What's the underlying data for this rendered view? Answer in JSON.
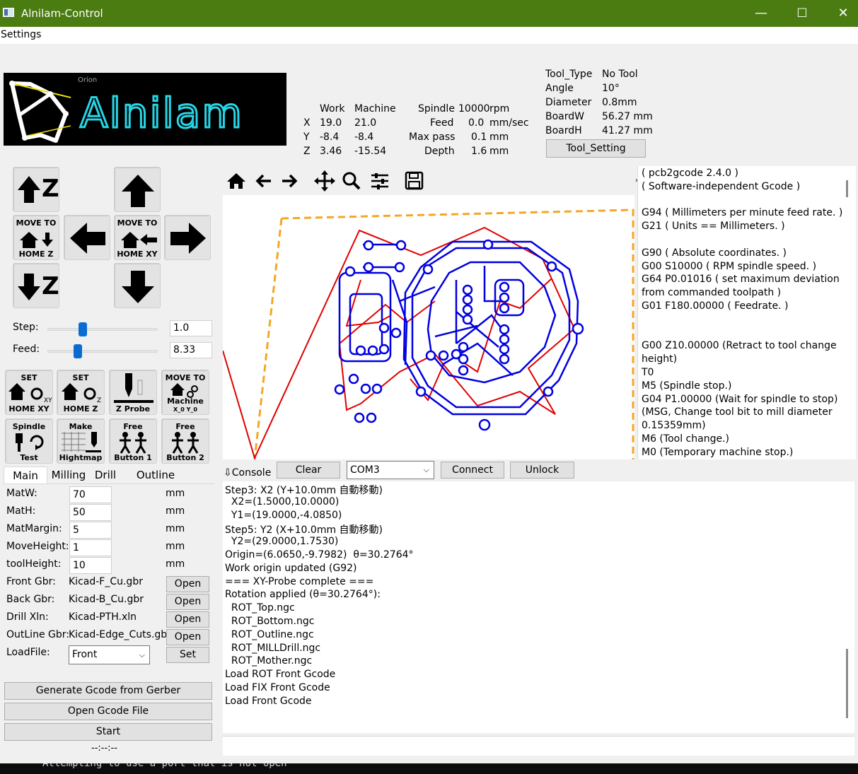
{
  "window": {
    "title": "Alnilam-Control",
    "minimize": "—",
    "maximize": "☐",
    "close": "✕"
  },
  "menu": {
    "settings": "Settings"
  },
  "logo": {
    "brand": "Alnilam",
    "sub": "Orion"
  },
  "coords": {
    "hdr_work": "Work",
    "hdr_machine": "Machine",
    "x_label": "X",
    "x_work": "19.0",
    "x_machine": "21.0",
    "y_label": "Y",
    "y_work": "-8.4",
    "y_machine": "-8.4",
    "z_label": "Z",
    "z_work": "3.46",
    "z_machine": "-15.54"
  },
  "spindle": {
    "spindle_label": "Spindle",
    "spindle_value": "10000",
    "spindle_unit": "rpm",
    "feed_label": "Feed",
    "feed_value": "0.0",
    "feed_unit": "mm/sec",
    "maxpass_label": "Max pass",
    "maxpass_value": "0.1",
    "maxpass_unit": "mm",
    "depth_label": "Depth",
    "depth_value": "1.6",
    "depth_unit": "mm"
  },
  "tool": {
    "type_label": "Tool_Type",
    "type_value": "No Tool",
    "angle_label": "Angle",
    "angle_value": "10°",
    "diameter_label": "Diameter",
    "diameter_value": "0.8mm",
    "boardw_label": "BoardW",
    "boardw_value": "56.27 mm",
    "boardh_label": "BoardH",
    "boardh_value": "41.27 mm",
    "setting_button": "Tool_Setting"
  },
  "jog": {
    "up_z": "Z",
    "down_z": "Z",
    "move_to": "MOVE TO",
    "home_z": "HOME Z",
    "home_xy": "HOME XY"
  },
  "step": {
    "label": "Step:",
    "value": "1.0",
    "level": 0.3
  },
  "feed": {
    "label": "Feed:",
    "value": "8.33",
    "level": 0.25
  },
  "func_buttons": {
    "set": "SET",
    "home_xy": "HOME XY",
    "home_z": "HOME Z",
    "z_probe": "Z Probe",
    "move_to": "MOVE TO",
    "machine": "Machine",
    "machine_sub": "X_0 Y_0",
    "spindle": "Spindle",
    "test": "Test",
    "make": "Make",
    "hightmap": "Hightmap",
    "free1": "Free",
    "button1": "Button 1",
    "free2": "Free",
    "button2": "Button 2"
  },
  "tabs": [
    "Main",
    "Milling",
    "Drill",
    "Outline"
  ],
  "params": {
    "matw_label": "MatW:",
    "matw": "70",
    "math_label": "MatH:",
    "math": "50",
    "matmargin_label": "MatMargin:",
    "matmargin": "5",
    "moveheight_label": "MoveHeight:",
    "moveheight": "1",
    "toolheight_label": "toolHeight:",
    "toolheight": "10",
    "unit": "mm"
  },
  "files": {
    "front_label": "Front Gbr:",
    "front": "Kicad-F_Cu.gbr",
    "back_label": "Back Gbr:",
    "back": "Kicad-B_Cu.gbr",
    "drill_label": "Drill Xln:",
    "drill": "Kicad-PTH.xln",
    "outline_label": "OutLine Gbr:",
    "outline": "Kicad-Edge_Cuts.gbr",
    "open": "Open",
    "loadfile_label": "LoadFile:",
    "loadfile": "Front",
    "set": "Set"
  },
  "actions": {
    "generate": "Generate Gcode from Gerber",
    "open_gcode": "Open Gcode File",
    "start": "Start",
    "time": "--:--:--"
  },
  "console_bar": {
    "console": "⇩Console",
    "clear": "Clear",
    "port": "COM3",
    "connect": "Connect",
    "unlock": "Unlock"
  },
  "gcode_lines": [
    "( pcb2gcode 2.4.0 )",
    "( Software-independent Gcode )",
    "",
    "G94 ( Millimeters per minute feed rate. )",
    "G21 ( Units == Millimeters. )",
    "",
    "G90 ( Absolute coordinates. )",
    "G00 S10000 ( RPM spindle speed. )",
    "G64 P0.01016 ( set maximum deviation",
    "from commanded toolpath )",
    "G01 F180.00000 ( Feedrate. )",
    "",
    "",
    "G00 Z10.00000 (Retract to tool change",
    "height)",
    "T0",
    "M5      (Spindle stop.)",
    "G04 P1.00000 (Wait for spindle to stop)",
    "(MSG, Change tool bit to mill diameter",
    "0.15359mm)",
    "M6      (Tool change.)",
    "M0      (Temporary machine stop.)"
  ],
  "console_lines": [
    "Step3: X2 (Y+10.0mm 自動移動)",
    "  X2=(1.5000,10.0000)",
    "  Y1=(19.0000,-4.0850)",
    "Step5: Y2 (X+10.0mm 自動移動)",
    "  Y2=(29.0000,1.7530)",
    "Origin=(6.0650,-9.7982)  θ=30.2764°",
    "Work origin updated (G92)",
    "=== XY-Probe complete ===",
    "Rotation applied (θ=30.2764°):",
    "  ROT_Top.ngc",
    "  ROT_Bottom.ngc",
    "  ROT_Outline.ngc",
    "  ROT_MILLDrill.ngc",
    "  ROT_Mother.ngc",
    "Load ROT Front Gcode",
    "Load FIX Front Gcode",
    "Load Front Gcode"
  ],
  "terminal": "Attempting to use a port that is not open",
  "colors": {
    "titlebar": "#4b7c12",
    "trace": "#0000e0",
    "travel": "#e00000",
    "outline": "#f5a623",
    "slider": "#0a6cd0"
  }
}
